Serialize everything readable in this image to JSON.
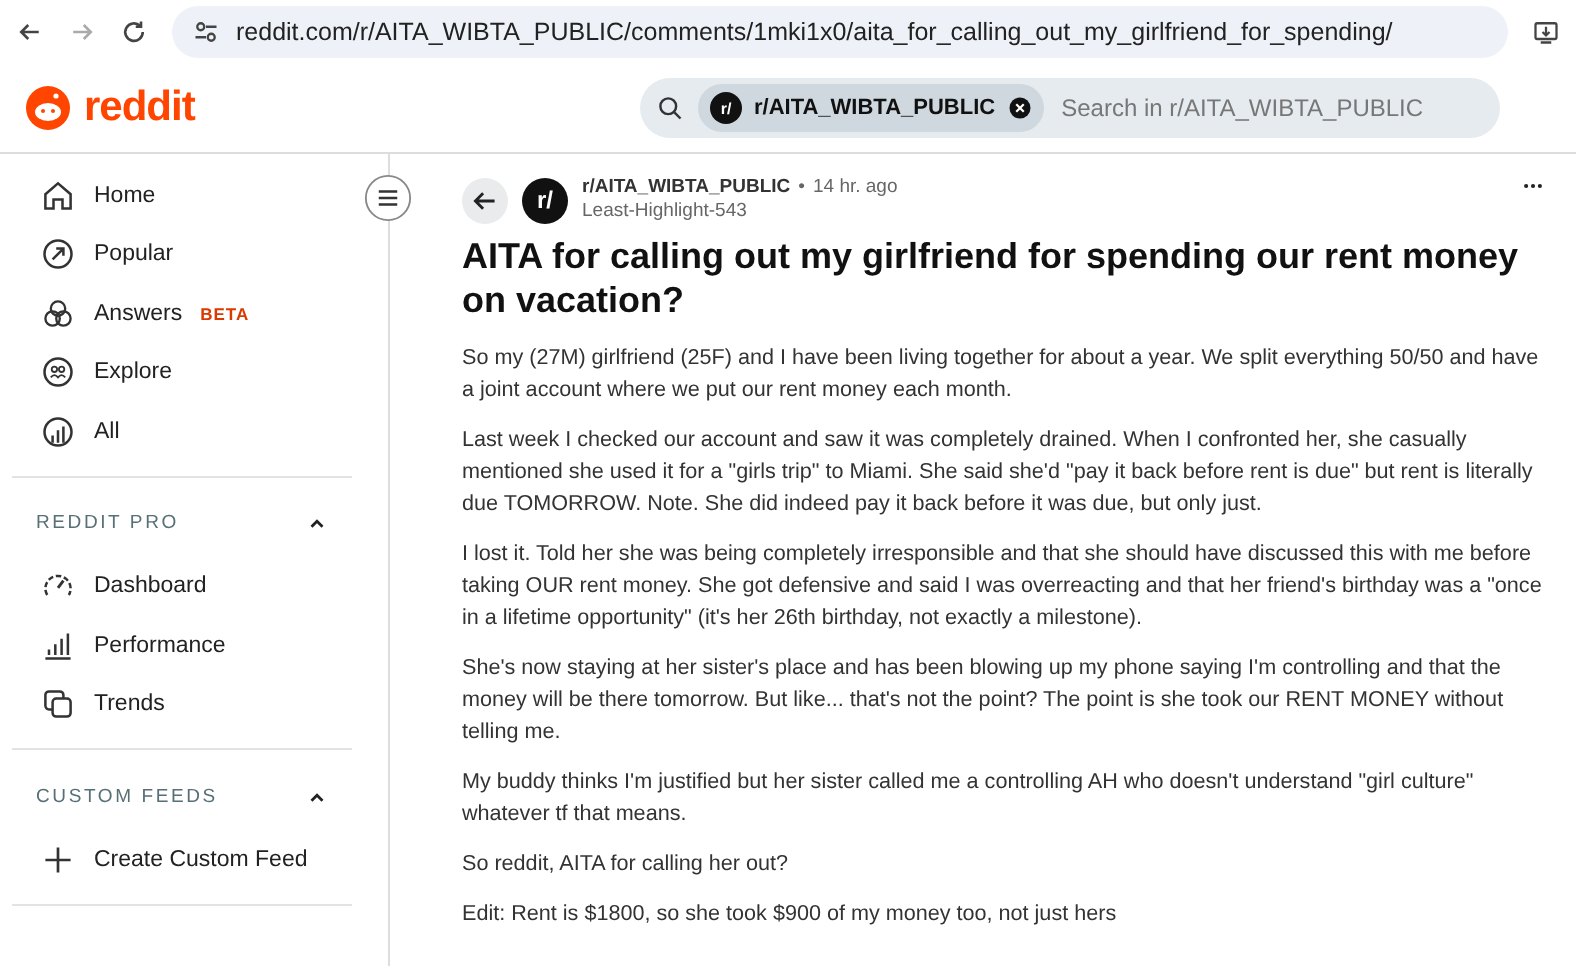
{
  "browser": {
    "url": "reddit.com/r/AITA_WIBTA_PUBLIC/comments/1mki1x0/aita_for_calling_out_my_girlfriend_for_spending/"
  },
  "header": {
    "logo": "reddit",
    "search_chip": "r/AITA_WIBTA_PUBLIC",
    "chip_avatar": "r/",
    "search_placeholder": "Search in r/AITA_WIBTA_PUBLIC"
  },
  "sidebar": {
    "items": [
      {
        "label": "Home"
      },
      {
        "label": "Popular"
      },
      {
        "label": "Answers",
        "badge": "BETA"
      },
      {
        "label": "Explore"
      },
      {
        "label": "All"
      }
    ],
    "sections": [
      {
        "title": "REDDIT PRO",
        "expanded": true,
        "items": [
          {
            "label": "Dashboard"
          },
          {
            "label": "Performance"
          },
          {
            "label": "Trends"
          }
        ]
      },
      {
        "title": "CUSTOM FEEDS",
        "expanded": true,
        "items": [
          {
            "label": "Create Custom Feed"
          }
        ]
      }
    ]
  },
  "post": {
    "avatar": "r/",
    "subreddit": "r/AITA_WIBTA_PUBLIC",
    "separator": "•",
    "time": "14 hr. ago",
    "author": "Least-Highlight-543",
    "title": "AITA for calling out my girlfriend for spending our rent money on vacation?",
    "paragraphs": [
      "So my (27M) girlfriend (25F) and I have been living together for about a year. We split everything 50/50 and have a joint account where we put our rent money each month.",
      "Last week I checked our account and saw it was completely drained. When I confronted her, she casually mentioned she used it for a \"girls trip\" to Miami. She said she'd \"pay it back before rent is due\" but rent is literally due TOMORROW. Note. She did indeed pay it back before it was due, but only just.",
      "I lost it. Told her she was being completely irresponsible and that she should have discussed this with me before taking OUR rent money. She got defensive and said I was overreacting and that her friend's birthday was a \"once in a lifetime opportunity\" (it's her 26th birthday, not exactly a milestone).",
      "She's now staying at her sister's place and has been blowing up my phone saying I'm controlling and that the money will be there tomorrow. But like... that's not the point? The point is she took our RENT MONEY without telling me.",
      "My buddy thinks I'm justified but her sister called me a controlling AH who doesn't understand \"girl culture\" whatever tf that means.",
      "So reddit, AITA for calling her out?",
      "Edit: Rent is $1800, so she took $900 of my money too, not just hers"
    ]
  }
}
